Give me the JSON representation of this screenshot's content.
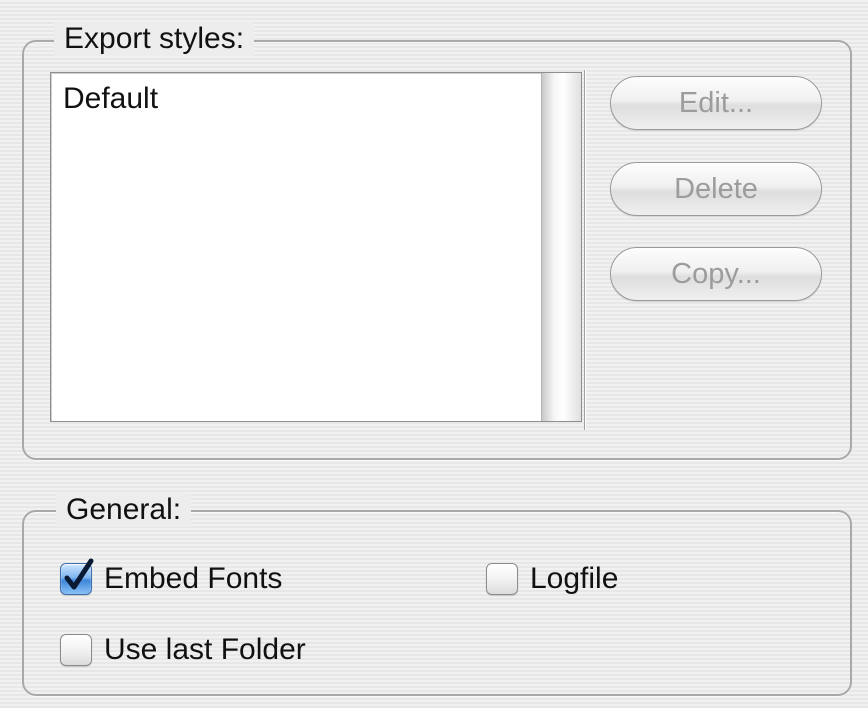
{
  "export_styles": {
    "title": "Export styles:",
    "items": [
      {
        "label": "Default"
      }
    ],
    "buttons": {
      "edit": "Edit...",
      "delete": "Delete",
      "copy": "Copy..."
    }
  },
  "general": {
    "title": "General:",
    "checkboxes": {
      "embed_fonts": {
        "label": "Embed Fonts",
        "checked": true
      },
      "logfile": {
        "label": "Logfile",
        "checked": false
      },
      "use_last_folder": {
        "label": "Use last Folder",
        "checked": false
      }
    }
  },
  "colors": {
    "accent": "#3d86d9",
    "disabled_text": "#9c9c9c",
    "group_border": "#a9a9a9"
  },
  "icons": {
    "check": "checkmark-icon"
  }
}
